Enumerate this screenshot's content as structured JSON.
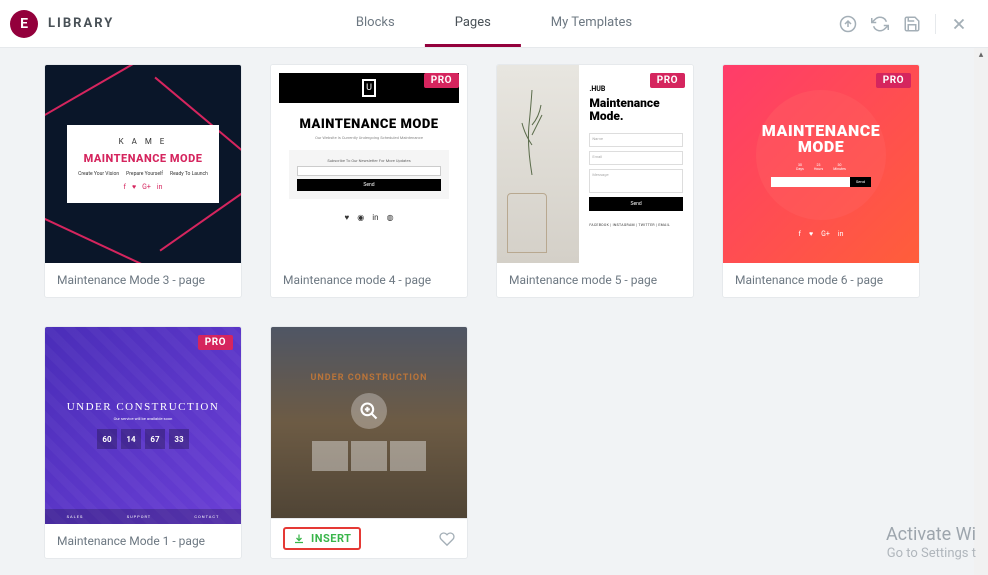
{
  "header": {
    "title": "LIBRARY",
    "tabs": [
      "Blocks",
      "Pages",
      "My Templates"
    ],
    "active_tab": 1
  },
  "badges": {
    "pro": "PRO"
  },
  "cards": [
    {
      "title": "Maintenance Mode 3 - page",
      "pro": true,
      "preview": {
        "logo": "K A M E",
        "heading": "MAINTENANCE MODE",
        "cols": [
          "Create Your Vision",
          "Prepare Yourself",
          "Ready To Launch"
        ]
      }
    },
    {
      "title": "Maintenance mode 4 - page",
      "pro": true,
      "preview": {
        "heading": "MAINTENANCE MODE",
        "sub": "Our Website Is Currently Undergoing Scheduled Maintenance",
        "form_sub": "Subscribe To Our Newsletter For More Updates",
        "btn": "Send"
      }
    },
    {
      "title": "Maintenance mode 5 - page",
      "pro": true,
      "preview": {
        "hub": ".HUB",
        "heading": "Maintenance Mode.",
        "fields": [
          "Name",
          "Email",
          "Message"
        ],
        "btn": "Send",
        "foot": "FACEBOOK | INSTAGRAM | TWITTER | EMAIL"
      }
    },
    {
      "title": "Maintenance mode 6 - page",
      "pro": true,
      "preview": {
        "heading": "MAINTENANCE MODE",
        "timers": [
          {
            "v": "30",
            "l": "Days"
          },
          {
            "v": "23",
            "l": "Hours"
          },
          {
            "v": "30",
            "l": "Minutes"
          }
        ],
        "btn": "Send"
      }
    },
    {
      "title": "Maintenance Mode 1 - page",
      "pro": true,
      "preview": {
        "heading": "UNDER CONSTRUCTION",
        "sub": "Our service will be available soon",
        "timers": [
          {
            "v": "60"
          },
          {
            "v": "14"
          },
          {
            "v": "67"
          },
          {
            "v": "33"
          }
        ],
        "foot": [
          "SALES",
          "SUPPORT",
          "CONTACT"
        ]
      }
    },
    {
      "hover": true,
      "preview": {
        "heading": "UNDER CONSTRUCTION"
      },
      "insert_label": "INSERT"
    }
  ],
  "watermark": {
    "line1": "Activate Wi",
    "line2": "Go to Settings t"
  }
}
